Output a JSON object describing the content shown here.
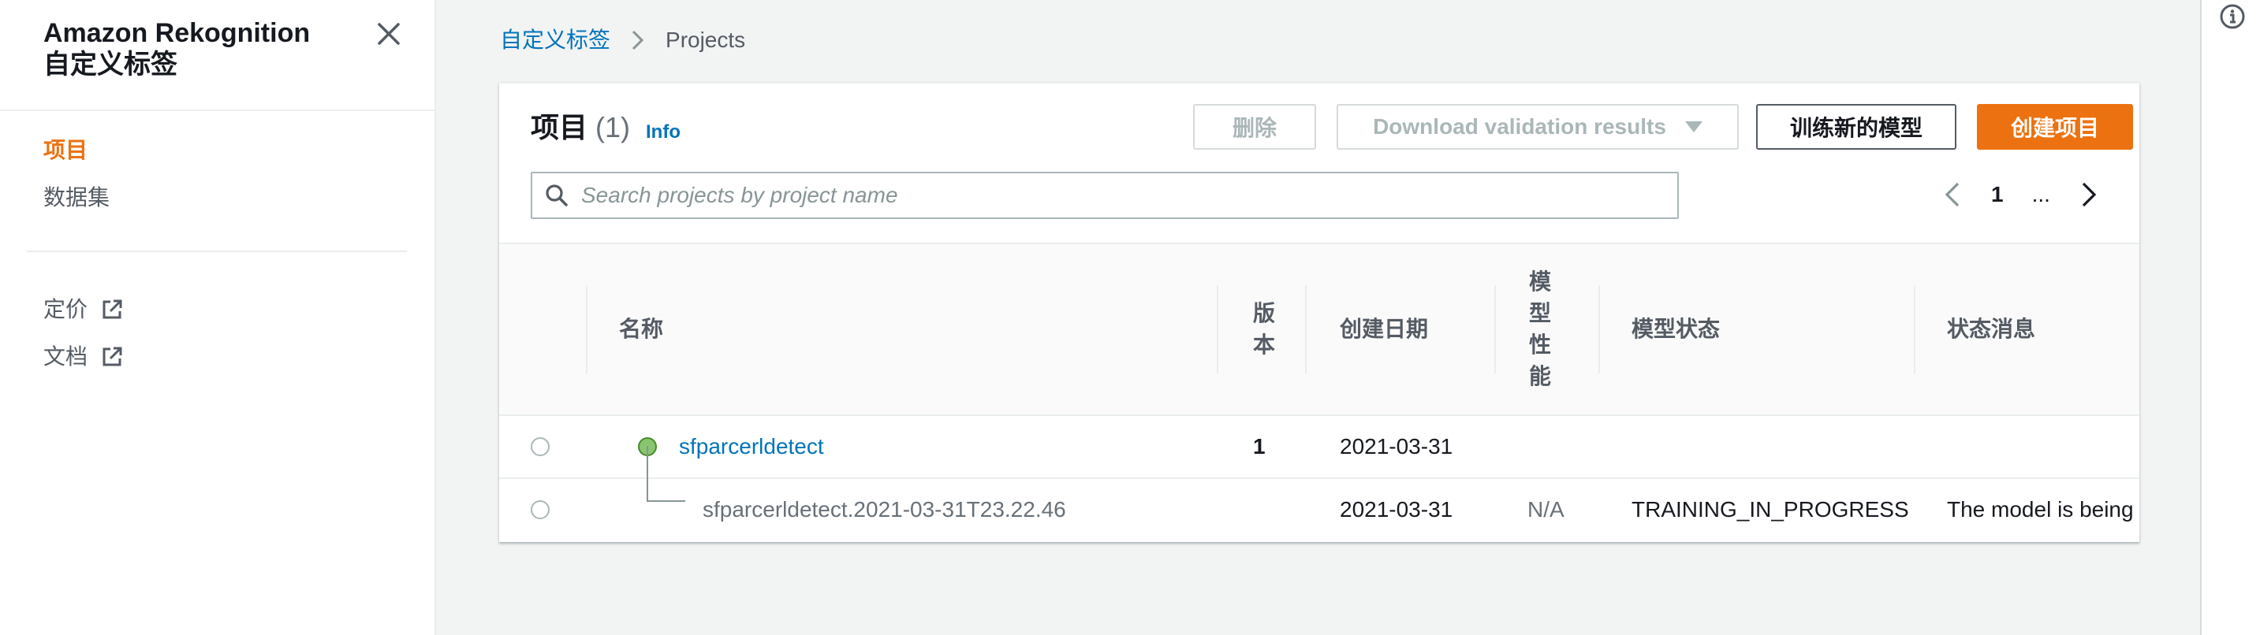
{
  "sidebar": {
    "title_line1": "Amazon Rekognition",
    "title_line2": "自定义标签",
    "items": [
      {
        "label": "项目",
        "active": true
      },
      {
        "label": "数据集",
        "active": false
      }
    ],
    "links": [
      {
        "label": "定价"
      },
      {
        "label": "文档"
      }
    ]
  },
  "breadcrumb": {
    "parent": "自定义标签",
    "current": "Projects"
  },
  "panel": {
    "title": "项目",
    "count": "(1)",
    "info": "Info",
    "buttons": {
      "delete": "删除",
      "download": "Download validation results",
      "train": "训练新的模型",
      "create": "创建项目"
    },
    "search_placeholder": "Search projects by project name",
    "pagination": {
      "page": "1",
      "ellipsis": "..."
    }
  },
  "table": {
    "columns": {
      "name": "名称",
      "version": "版本",
      "created": "创建日期",
      "performance": "模型性能",
      "model_status": "模型状态",
      "status_message": "状态消息"
    },
    "rows": [
      {
        "name": "sfparcerldetect",
        "version": "1",
        "created": "2021-03-31",
        "performance": "",
        "model_status": "",
        "status_message": ""
      },
      {
        "name": "sfparcerldetect.2021-03-31T23.22.46",
        "version": "",
        "created": "2021-03-31",
        "performance": "N/A",
        "model_status": "TRAINING_IN_PROGRESS",
        "status_message": "The model is being"
      }
    ]
  },
  "colors": {
    "accent": "#ec7211",
    "link": "#0073bb",
    "background": "#f2f3f3",
    "status_dot": "#89c46f"
  },
  "icons": [
    "close-icon",
    "external-link-icon",
    "info-circle-icon",
    "search-icon",
    "chevron-left-icon",
    "chevron-right-icon",
    "caret-down-icon"
  ]
}
